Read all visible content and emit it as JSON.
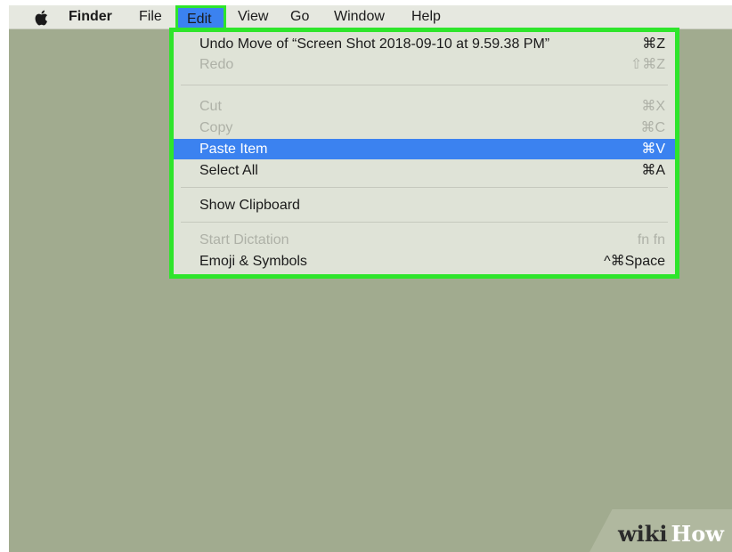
{
  "menubar": {
    "apple_icon": "apple-logo",
    "app_name": "Finder",
    "items": [
      "File",
      "Edit",
      "View",
      "Go",
      "Window",
      "Help"
    ],
    "active_item": "Edit"
  },
  "edit_menu": {
    "items": [
      {
        "label": "Undo Move of “Screen Shot 2018-09-10 at 9.59.38 PM”",
        "shortcut": "⌘Z",
        "enabled": true
      },
      {
        "label": "Redo",
        "shortcut": "⇧⌘Z",
        "enabled": false
      },
      {
        "label": "Cut",
        "shortcut": "⌘X",
        "enabled": false
      },
      {
        "label": "Copy",
        "shortcut": "⌘C",
        "enabled": false
      },
      {
        "label": "Paste Item",
        "shortcut": "⌘V",
        "enabled": true,
        "selected": true
      },
      {
        "label": "Select All",
        "shortcut": "⌘A",
        "enabled": true
      },
      {
        "label": "Show Clipboard",
        "shortcut": "",
        "enabled": true
      },
      {
        "label": "Start Dictation",
        "shortcut": "fn fn",
        "enabled": false
      },
      {
        "label": "Emoji & Symbols",
        "shortcut": "^⌘Space",
        "enabled": true
      }
    ]
  },
  "watermark": {
    "part1": "wiki",
    "part2": "How"
  },
  "colors": {
    "desktop": "#a1ab8f",
    "highlight_border": "#2ee52b",
    "selection": "#3b82f0"
  }
}
